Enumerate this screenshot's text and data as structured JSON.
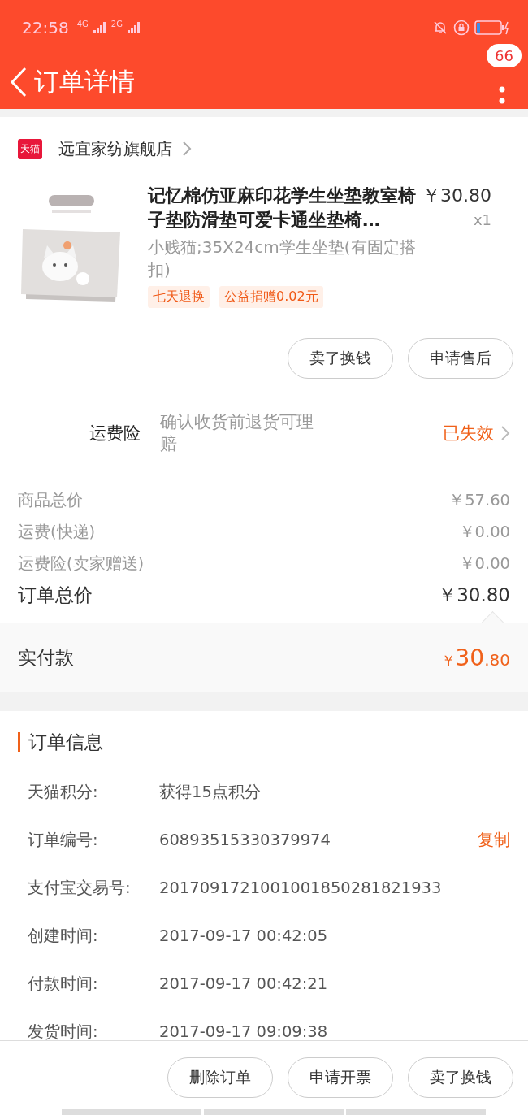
{
  "status_bar": {
    "time": "22:58",
    "network_1": "4G",
    "network_2": "2G"
  },
  "header": {
    "title": "订单详情",
    "badge": "66"
  },
  "store": {
    "platform": "天猫",
    "name": "远宜家纺旗舰店"
  },
  "product": {
    "title": "记忆棉仿亚麻印花学生坐垫教室椅子垫防滑垫可爱卡通坐垫椅…",
    "price": "￥30.80",
    "quantity": "x1",
    "sku": "小贱猫;35X24cm学生坐垫(有固定搭扣)",
    "tags": [
      "七天退换",
      "公益捐赠0.02元"
    ],
    "actions": [
      "卖了换钱",
      "申请售后"
    ]
  },
  "insurance": {
    "label": "运费险",
    "description": "确认收货前退货可理赔",
    "status": "已失效"
  },
  "costs": [
    {
      "label": "商品总价",
      "value": "￥57.60"
    },
    {
      "label": "运费(快递)",
      "value": "￥0.00"
    },
    {
      "label": "运费险(卖家赠送)",
      "value": "￥0.00"
    }
  ],
  "total": {
    "label": "订单总价",
    "value": "￥30.80"
  },
  "paid": {
    "label": "实付款",
    "currency": "￥",
    "integer": "30",
    "decimal": ".80"
  },
  "order_info": {
    "title": "订单信息",
    "rows": [
      {
        "label": "天猫积分:",
        "value": "获得15点积分"
      },
      {
        "label": "订单编号:",
        "value": "60893515330379974",
        "action": "复制"
      },
      {
        "label": "支付宝交易号:",
        "value": "2017091721001001850281821933"
      },
      {
        "label": "创建时间:",
        "value": "2017-09-17 00:42:05"
      },
      {
        "label": "付款时间:",
        "value": "2017-09-17 00:42:21"
      },
      {
        "label": "发货时间:",
        "value": "2017-09-17 09:09:38"
      }
    ]
  },
  "bottom_actions": [
    "删除订单",
    "申请开票",
    "卖了换钱"
  ]
}
